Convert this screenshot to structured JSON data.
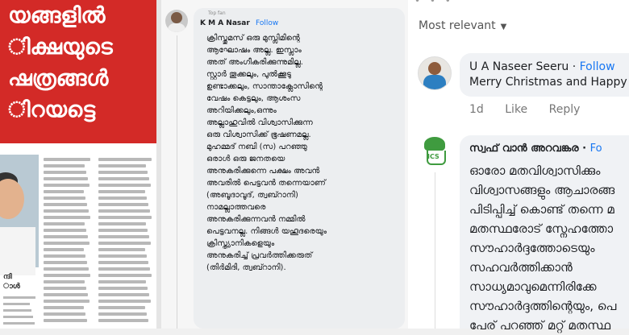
{
  "newspaper": {
    "headline_lines": [
      "യങ്ങളിൽ",
      "ിക്ഷയുടെ",
      "ഷത്രങ്ങൾ",
      "ിറയട്ടെ"
    ],
    "photo_caption_lines": [
      "ന്ദി",
      "ാൾ"
    ]
  },
  "post": {
    "badge": "Top fan",
    "author": "K M A Nasar",
    "follow": "Follow",
    "lines": [
      "ക്രിസ്തുമസ് ഒരു മുസ്ലിമിന്റെ",
      "ആഘോഷം അല്ല. ഇസ്ലാം",
      "അത് അംഗീകരിക്കുന്നുമില്ല.",
      "സ്റ്റാർ തൂക്കലും, പുൽക്കൂടു",
      "ഉണ്ടാക്കലും, സാന്താക്ലോസിന്റെ",
      "വേഷം കെട്ടലും, ആശംസ",
      "അറിയിക്കലും,ഒന്നും",
      "അല്ലാഹുവിൽ വിശ്വാസിക്കുന്ന",
      "ഒരു വിശ്വാസിക്ക് ഭൂഷണമല്ല.",
      "മുഹമ്മദ് നബി (സ) പറഞ്ഞു",
      "ഒരാൾ ഒരു ജനതയെ",
      "അനുകരിക്കുന്നെ പക്ഷം അവൻ",
      "അവരിൽ പെട്ടവൻ തന്നെയാണ്",
      "(അബൂദാവൂദ്, ത്വബ്റാനി)",
      "നാമല്ലാത്തവരെ",
      "അനുകരിക്കുന്നവൻ നമ്മിൽ",
      "പെട്ടവനല്ല. നിങ്ങൾ യഹൂദരെയും",
      "ക്രിസ്ത്യാനികളെയും",
      "അനുകരിച്ച് പ്രവർത്തിക്കരുത്",
      "(തിർമിദി, ത്വബ്റാനി)."
    ]
  },
  "comments": {
    "sort_label": "Most relevant",
    "items": [
      {
        "author": "U A Naseer Seeru",
        "follow": "Follow",
        "text": "Merry Christmas and Happy",
        "time": "1d",
        "like": "Like",
        "reply": "Reply"
      },
      {
        "author": "സ്വഫ് വാൻ അറവങ്കര",
        "follow": "Fo",
        "avatar_text": "ICS",
        "lines": [
          "ഓരോ മതവിശ്വാസിക്കും",
          "വിശ്വാസങ്ങളും ആചാരങ്ങ",
          "പിടിപ്പിച്ച് കൊണ്ട് തന്നെ മ",
          "മതസ്ഥരോട് സ്നേഹത്തോ",
          "സൗഹാർദ്ദത്തോടെയും",
          "സഹവർത്തിക്കാൻ",
          "സാധ്യമാവുമെന്നിരിക്കേ",
          "സൗഹാർദ്ദത്തിന്റെയും, പെ",
          "പേര് പറഞ്ഞ് മറ്റ് മതസ്ഥ"
        ]
      }
    ]
  }
}
